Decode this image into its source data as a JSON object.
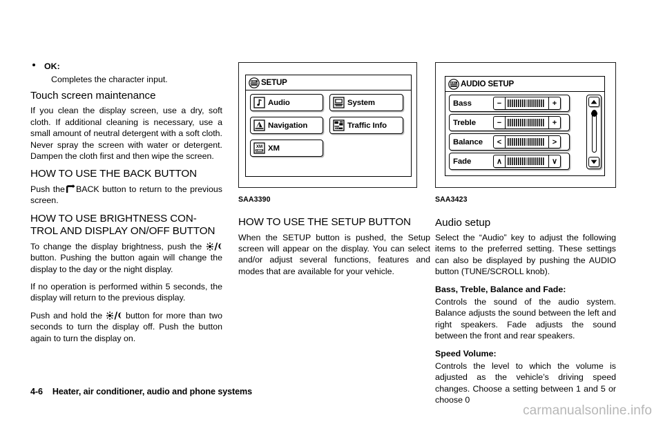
{
  "page": {
    "number": "4-6",
    "footer_title": "Heater, air conditioner, audio and phone systems",
    "watermark": "carmanualsonline.info"
  },
  "column1": {
    "bullet": {
      "title": "OK:",
      "description": "Completes the character input."
    },
    "heading_touch": "Touch screen maintenance",
    "para_touch": "If you clean the display screen, use a dry, soft cloth. If additional cleaning is necessary, use a small amount of neutral detergent with a soft cloth. Never spray the screen with water or detergent. Dampen the cloth first and then wipe the screen.",
    "heading_back": "HOW TO USE THE BACK BUTTON",
    "para_back_pre": "Push the",
    "para_back_post": "BACK button to return to the previous screen.",
    "heading_brightness": "HOW TO USE BRIGHTNESS CON-\nTROL AND DISPLAY ON/OFF BUTTON",
    "para_bright_1_pre": "To change the display brightness, push the",
    "para_bright_1_post": "button. Pushing the button again will change the display to the day or the night display.",
    "para_bright_2": "If no operation is performed within 5 seconds, the display will return to the previous display.",
    "para_bright_3_pre": "Push and hold the",
    "para_bright_3_post": "button for more than two seconds to turn the display off. Push the button again to turn the display on."
  },
  "figure_setup": {
    "caption": "SAA3390",
    "screen_title": "SETUP",
    "menu_items": [
      {
        "label": "Audio",
        "icon": "music-note-icon"
      },
      {
        "label": "System",
        "icon": "monitor-icon"
      },
      {
        "label": "Navigation",
        "icon": "navigation-arrow-icon"
      },
      {
        "label": "Traffic Info",
        "icon": "traffic-icon"
      },
      {
        "label": "XM",
        "icon": "xm-radio-icon"
      }
    ]
  },
  "figure_audio": {
    "caption": "SAA3423",
    "screen_title": "AUDIO SETUP",
    "rows": [
      {
        "label": "Bass",
        "left_btn": "−",
        "right_btn": "+",
        "left_icon": "minus-icon",
        "right_icon": "plus-icon"
      },
      {
        "label": "Treble",
        "left_btn": "−",
        "right_btn": "+",
        "left_icon": "minus-icon",
        "right_icon": "plus-icon"
      },
      {
        "label": "Balance",
        "left_btn": "<",
        "right_btn": ">",
        "left_icon": "arrow-left-icon",
        "right_icon": "arrow-right-icon"
      },
      {
        "label": "Fade",
        "left_btn": "∧",
        "right_btn": "∨",
        "left_icon": "arrow-up-icon",
        "right_icon": "arrow-down-icon"
      }
    ],
    "scrollbar": {
      "up_icon": "scroll-up-arrow-icon",
      "down_icon": "scroll-down-arrow-icon"
    }
  },
  "column2": {
    "heading_setup": "HOW TO USE THE SETUP BUTTON",
    "para_setup": "When the SETUP button is pushed, the Setup screen will appear on the display. You can select and/or adjust several functions, features and modes that are available for your vehicle."
  },
  "column3": {
    "heading_audio_setup": "Audio setup",
    "para_audio_setup": "Select the “Audio” key to adjust the following items to the preferred setting. These settings can also be displayed by pushing the AUDIO button (TUNE/SCROLL knob).",
    "lead_bass": "Bass, Treble, Balance and Fade:",
    "para_bass": "Controls the sound of the audio system. Balance adjusts the sound between the left and right speakers. Fade adjusts the sound between the front and rear speakers.",
    "lead_speed": "Speed Volume:",
    "para_speed": "Controls the level to which the volume is adjusted as the vehicle’s driving speed changes. Choose a setting between 1 and 5 or choose 0"
  }
}
